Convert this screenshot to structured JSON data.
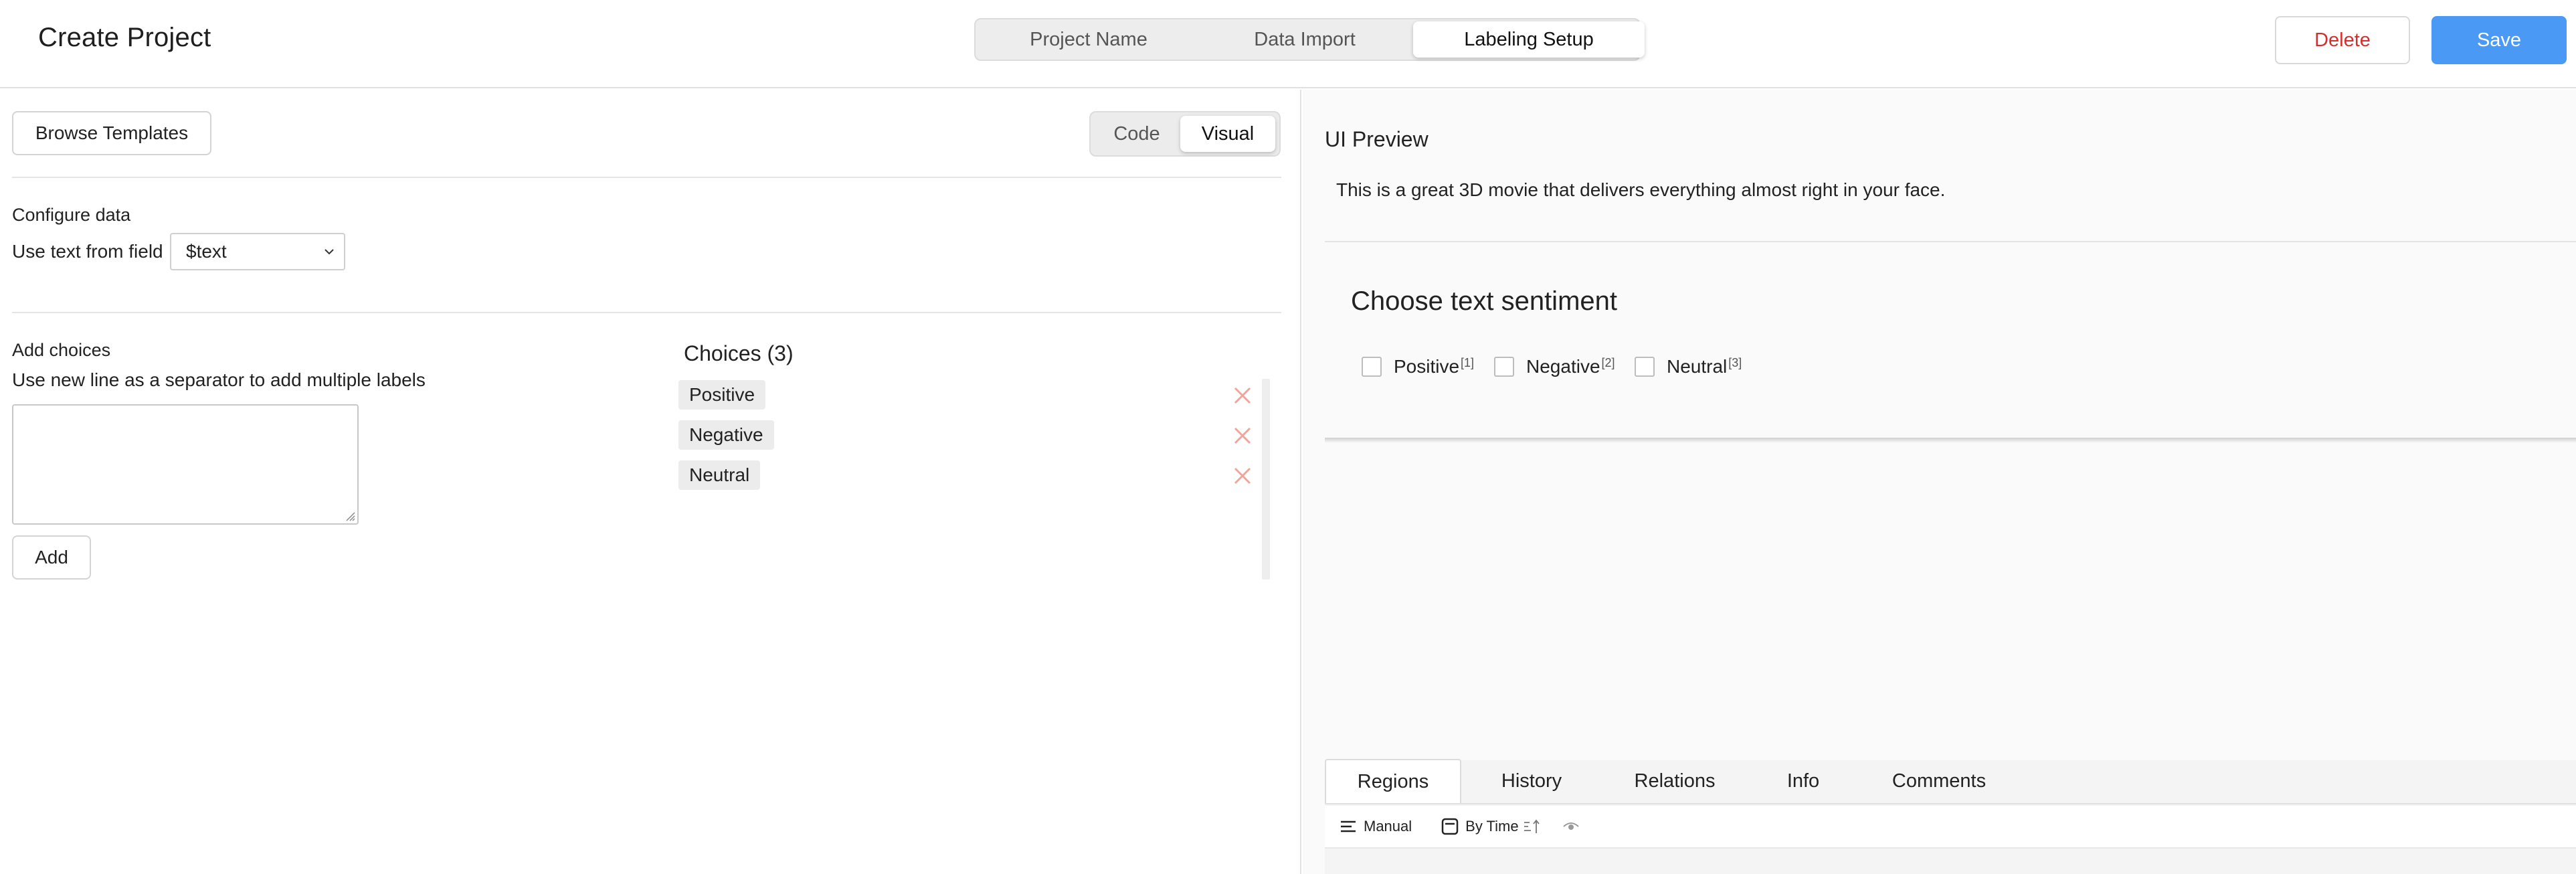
{
  "header": {
    "title": "Create Project",
    "steps": [
      {
        "label": "Project Name"
      },
      {
        "label": "Data Import"
      },
      {
        "label": "Labeling Setup",
        "active": true
      }
    ],
    "delete_label": "Delete",
    "save_label": "Save"
  },
  "left": {
    "browse_label": "Browse Templates",
    "toggle": [
      {
        "label": "Code"
      },
      {
        "label": "Visual",
        "active": true
      }
    ],
    "configure_title": "Configure data",
    "field_label": "Use text from field",
    "field_value": "$text",
    "add_title": "Add choices",
    "add_hint": "Use new line as a separator to add multiple labels",
    "textarea_value": "",
    "add_label": "Add",
    "choices_title": "Choices (3)",
    "choices": [
      {
        "label": "Positive"
      },
      {
        "label": "Negative"
      },
      {
        "label": "Neutral"
      }
    ]
  },
  "preview": {
    "title": "UI Preview",
    "text": "This is a great 3D movie that delivers everything almost right in your face.",
    "question": "Choose text sentiment",
    "options": [
      {
        "label": "Positive",
        "hotkey": "[1]"
      },
      {
        "label": "Negative",
        "hotkey": "[2]"
      },
      {
        "label": "Neutral",
        "hotkey": "[3]"
      }
    ],
    "tabs": [
      {
        "label": "Regions",
        "active": true
      },
      {
        "label": "History"
      },
      {
        "label": "Relations"
      },
      {
        "label": "Info"
      },
      {
        "label": "Comments"
      }
    ],
    "toolbar": {
      "order_label": "Manual",
      "sort_label": "By Time"
    }
  },
  "colors": {
    "accent": "#4a9af5",
    "danger": "#d42e2e",
    "remove_x": "#f0a49a"
  },
  "icons": [
    "chevron-down-icon",
    "close-icon",
    "list-order-icon",
    "sort-icon",
    "sort-direction-icon",
    "eye-icon",
    "resize-grip-icon"
  ]
}
